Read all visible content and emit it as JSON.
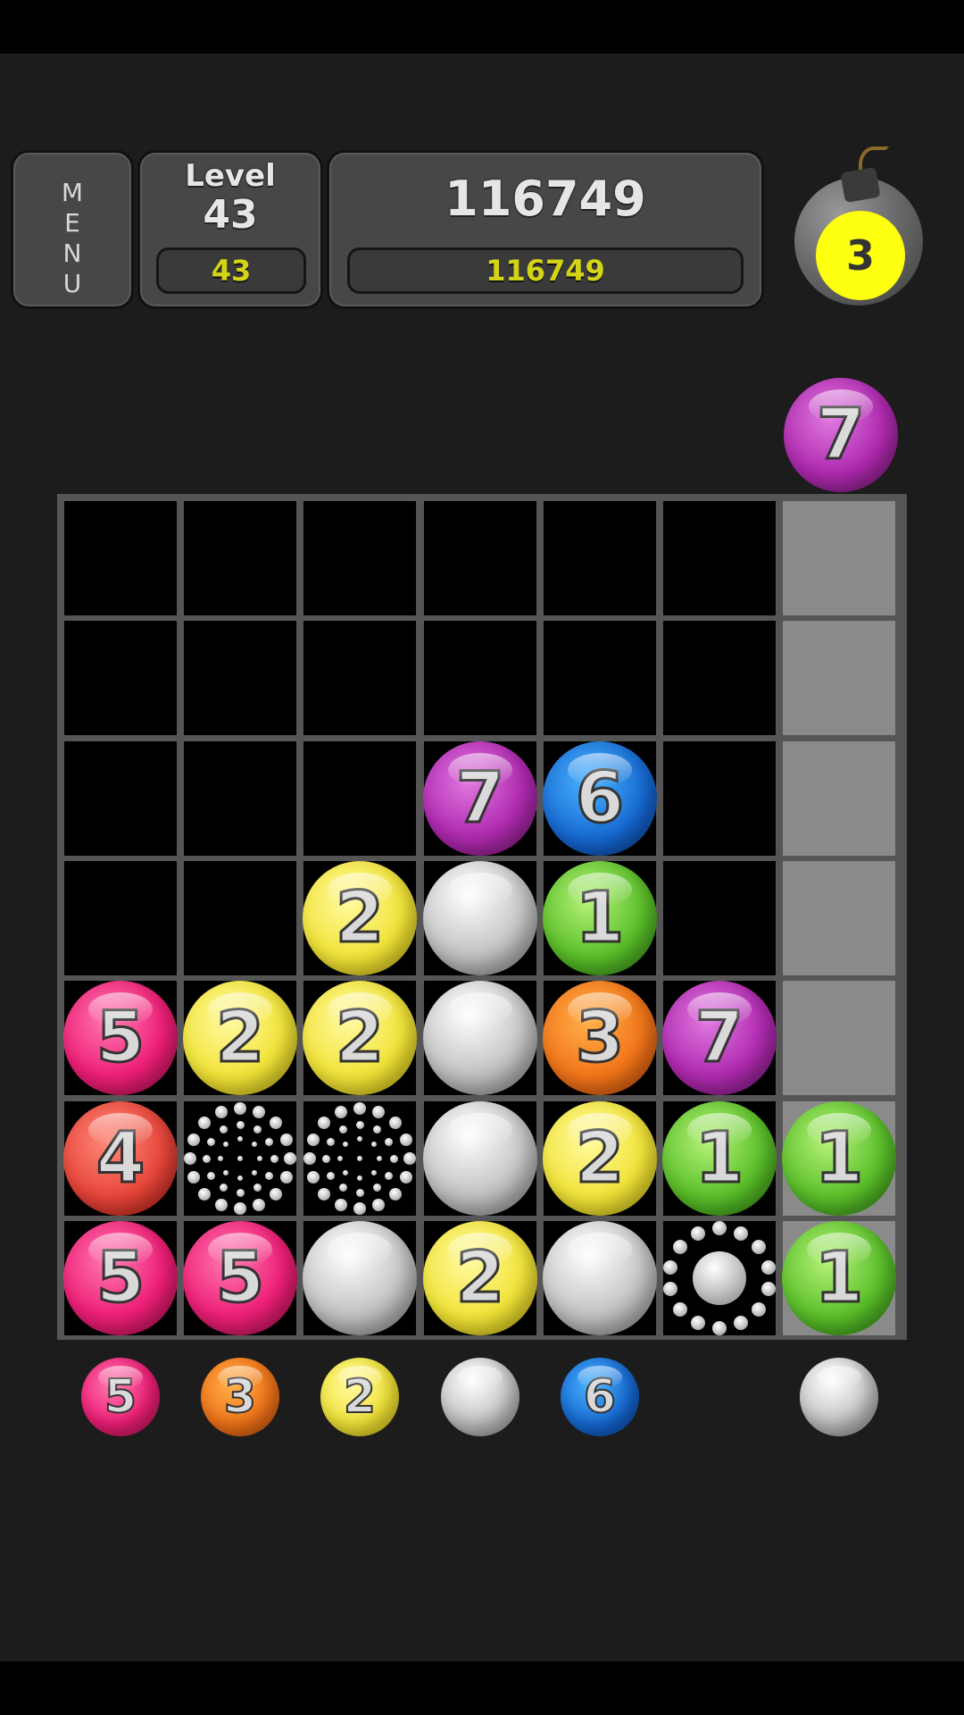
{
  "header": {
    "menu_label": "MENU",
    "level_label": "Level",
    "level_value": "43",
    "level_badge": "43",
    "score_value": "116749",
    "score_badge": "116749"
  },
  "bomb": {
    "count": "3"
  },
  "next_ball": {
    "color": "magenta",
    "value": "7"
  },
  "board": {
    "columns": 7,
    "rows": 7,
    "drop_column": 7,
    "cells": [
      {
        "row": 3,
        "col": 4,
        "type": "ball",
        "color": "magenta",
        "value": "7"
      },
      {
        "row": 3,
        "col": 5,
        "type": "ball",
        "color": "blue",
        "value": "6"
      },
      {
        "row": 4,
        "col": 3,
        "type": "ball",
        "color": "yellow",
        "value": "2"
      },
      {
        "row": 4,
        "col": 4,
        "type": "gray"
      },
      {
        "row": 4,
        "col": 5,
        "type": "ball",
        "color": "green",
        "value": "1"
      },
      {
        "row": 5,
        "col": 1,
        "type": "ball",
        "color": "pink",
        "value": "5"
      },
      {
        "row": 5,
        "col": 2,
        "type": "ball",
        "color": "yellow",
        "value": "2"
      },
      {
        "row": 5,
        "col": 3,
        "type": "ball",
        "color": "yellow",
        "value": "2"
      },
      {
        "row": 5,
        "col": 4,
        "type": "gray"
      },
      {
        "row": 5,
        "col": 5,
        "type": "ball",
        "color": "orange",
        "value": "3"
      },
      {
        "row": 5,
        "col": 6,
        "type": "ball",
        "color": "magenta",
        "value": "7"
      },
      {
        "row": 6,
        "col": 1,
        "type": "ball",
        "color": "red",
        "value": "4"
      },
      {
        "row": 6,
        "col": 2,
        "type": "ring"
      },
      {
        "row": 6,
        "col": 3,
        "type": "ring"
      },
      {
        "row": 6,
        "col": 4,
        "type": "gray"
      },
      {
        "row": 6,
        "col": 5,
        "type": "ball",
        "color": "yellow",
        "value": "2"
      },
      {
        "row": 6,
        "col": 6,
        "type": "ball",
        "color": "green",
        "value": "1"
      },
      {
        "row": 6,
        "col": 7,
        "type": "ball",
        "color": "green",
        "value": "1"
      },
      {
        "row": 7,
        "col": 1,
        "type": "ball",
        "color": "pink",
        "value": "5"
      },
      {
        "row": 7,
        "col": 2,
        "type": "ball",
        "color": "pink",
        "value": "5"
      },
      {
        "row": 7,
        "col": 3,
        "type": "gray"
      },
      {
        "row": 7,
        "col": 4,
        "type": "ball",
        "color": "yellow",
        "value": "2"
      },
      {
        "row": 7,
        "col": 5,
        "type": "gray"
      },
      {
        "row": 7,
        "col": 6,
        "type": "ring-core"
      },
      {
        "row": 7,
        "col": 7,
        "type": "ball",
        "color": "green",
        "value": "1"
      }
    ]
  },
  "preview_row": [
    {
      "col": 1,
      "color": "pink",
      "value": "5"
    },
    {
      "col": 2,
      "color": "orange",
      "value": "3"
    },
    {
      "col": 3,
      "color": "yellow",
      "value": "2"
    },
    {
      "col": 4,
      "color": "gray",
      "value": ""
    },
    {
      "col": 5,
      "color": "blue",
      "value": "6"
    },
    {
      "col": 7,
      "color": "gray",
      "value": ""
    }
  ]
}
